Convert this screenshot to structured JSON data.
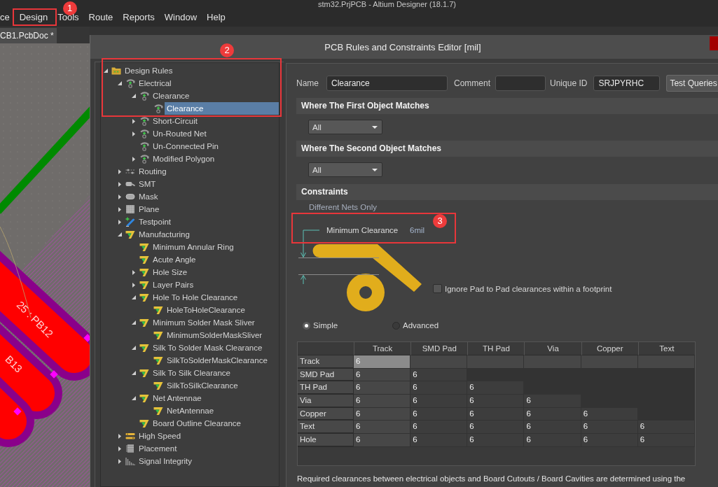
{
  "window": {
    "title": "stm32.PrjPCB - Altium Designer (18.1.7)"
  },
  "menu": [
    {
      "label": "ce"
    },
    {
      "label": "Design",
      "callout": "1"
    },
    {
      "label": "Tools"
    },
    {
      "label": "Route"
    },
    {
      "label": "Reports"
    },
    {
      "label": "Window"
    },
    {
      "label": "Help"
    }
  ],
  "document_tabs": [
    {
      "label": "CB1.PcbDoc *",
      "selected": true
    }
  ],
  "pcb_view": {
    "labels": [
      "25 : PB12",
      "B13"
    ]
  },
  "dialog": {
    "title": "PCB Rules and Constraints Editor [mil]",
    "rule_tree": {
      "callout": "2",
      "items": [
        {
          "label": "Design Rules",
          "kind": "folder",
          "expanded": true,
          "selected": false,
          "children": [
            {
              "label": "Electrical",
              "kind": "electrical",
              "expanded": true,
              "selected": false,
              "children": [
                {
                  "label": "Clearance",
                  "kind": "electrical",
                  "expanded": true,
                  "selected": false,
                  "children": [
                    {
                      "label": "Clearance",
                      "kind": "electrical",
                      "selected": true
                    }
                  ]
                },
                {
                  "label": "Short-Circuit",
                  "kind": "electrical",
                  "expanded": false,
                  "selected": false
                },
                {
                  "label": "Un-Routed Net",
                  "kind": "electrical",
                  "expanded": false,
                  "selected": false
                },
                {
                  "label": "Un-Connected Pin",
                  "kind": "electrical",
                  "selected": false
                },
                {
                  "label": "Modified Polygon",
                  "kind": "electrical",
                  "expanded": false,
                  "selected": false
                }
              ]
            },
            {
              "label": "Routing",
              "kind": "routing",
              "expanded": false,
              "selected": false
            },
            {
              "label": "SMT",
              "kind": "smt",
              "expanded": false,
              "selected": false
            },
            {
              "label": "Mask",
              "kind": "mask",
              "expanded": false,
              "selected": false
            },
            {
              "label": "Plane",
              "kind": "plane",
              "expanded": false,
              "selected": false
            },
            {
              "label": "Testpoint",
              "kind": "testpoint",
              "expanded": false,
              "selected": false
            },
            {
              "label": "Manufacturing",
              "kind": "manufacturing",
              "expanded": true,
              "selected": false,
              "children": [
                {
                  "label": "Minimum Annular Ring",
                  "kind": "manufacturing",
                  "selected": false
                },
                {
                  "label": "Acute Angle",
                  "kind": "manufacturing",
                  "selected": false
                },
                {
                  "label": "Hole Size",
                  "kind": "manufacturing",
                  "expanded": false,
                  "selected": false
                },
                {
                  "label": "Layer Pairs",
                  "kind": "manufacturing",
                  "expanded": false,
                  "selected": false
                },
                {
                  "label": "Hole To Hole Clearance",
                  "kind": "manufacturing",
                  "expanded": true,
                  "selected": false,
                  "children": [
                    {
                      "label": "HoleToHoleClearance",
                      "kind": "manufacturing",
                      "selected": false
                    }
                  ]
                },
                {
                  "label": "Minimum Solder Mask Sliver",
                  "kind": "manufacturing",
                  "expanded": true,
                  "selected": false,
                  "children": [
                    {
                      "label": "MinimumSolderMaskSliver",
                      "kind": "manufacturing",
                      "selected": false
                    }
                  ]
                },
                {
                  "label": "Silk To Solder Mask Clearance",
                  "kind": "manufacturing",
                  "expanded": true,
                  "selected": false,
                  "children": [
                    {
                      "label": "SilkToSolderMaskClearance",
                      "kind": "manufacturing",
                      "selected": false
                    }
                  ]
                },
                {
                  "label": "Silk To Silk Clearance",
                  "kind": "manufacturing",
                  "expanded": true,
                  "selected": false,
                  "children": [
                    {
                      "label": "SilkToSilkClearance",
                      "kind": "manufacturing",
                      "selected": false
                    }
                  ]
                },
                {
                  "label": "Net Antennae",
                  "kind": "manufacturing",
                  "expanded": true,
                  "selected": false,
                  "children": [
                    {
                      "label": "NetAntennae",
                      "kind": "manufacturing",
                      "selected": false
                    }
                  ]
                },
                {
                  "label": "Board Outline Clearance",
                  "kind": "manufacturing",
                  "selected": false
                }
              ]
            },
            {
              "label": "High Speed",
              "kind": "high-speed",
              "expanded": false,
              "selected": false
            },
            {
              "label": "Placement",
              "kind": "placement",
              "expanded": false,
              "selected": false
            },
            {
              "label": "Signal Integrity",
              "kind": "signal-integrity",
              "expanded": false,
              "selected": false
            }
          ]
        }
      ]
    },
    "rule": {
      "name_label": "Name",
      "name": "Clearance",
      "comment_label": "Comment",
      "unique_id_label": "Unique ID",
      "unique_id": "SRJPYRHC",
      "test_button": "Test Queries"
    },
    "first_match": {
      "heading": "Where The First Object Matches",
      "query": "All"
    },
    "second_match": {
      "heading": "Where The Second Object Matches",
      "query": "All"
    },
    "constraints": {
      "heading": "Constraints",
      "callout": "3",
      "net_scope": "Different Nets Only",
      "min_clearance_label": "Minimum Clearance",
      "min_clearance": "6mil",
      "ignore_pad_to_pad": {
        "label": "Ignore Pad to Pad clearances within a footprint",
        "checked": false
      },
      "modes": [
        {
          "label": "Simple",
          "selected": true
        },
        {
          "label": "Advanced",
          "selected": false
        }
      ],
      "matrix": {
        "columns": [
          "Track",
          "SMD Pad",
          "TH Pad",
          "Via",
          "Copper",
          "Text"
        ],
        "rows": [
          {
            "label": "Track",
            "cells": [
              {
                "value": "6",
                "selected": true
              }
            ]
          },
          {
            "label": "SMD Pad",
            "cells": [
              {
                "value": "6",
                "selected": false
              },
              {
                "value": "6",
                "selected": false
              }
            ]
          },
          {
            "label": "TH Pad",
            "cells": [
              {
                "value": "6",
                "selected": false
              },
              {
                "value": "6",
                "selected": false
              },
              {
                "value": "6",
                "selected": false
              }
            ]
          },
          {
            "label": "Via",
            "cells": [
              {
                "value": "6",
                "selected": false
              },
              {
                "value": "6",
                "selected": false
              },
              {
                "value": "6",
                "selected": false
              },
              {
                "value": "6",
                "selected": false
              }
            ]
          },
          {
            "label": "Copper",
            "cells": [
              {
                "value": "6",
                "selected": false
              },
              {
                "value": "6",
                "selected": false
              },
              {
                "value": "6",
                "selected": false
              },
              {
                "value": "6",
                "selected": false
              },
              {
                "value": "6",
                "selected": false
              }
            ]
          },
          {
            "label": "Text",
            "cells": [
              {
                "value": "6",
                "selected": false
              },
              {
                "value": "6",
                "selected": false
              },
              {
                "value": "6",
                "selected": false
              },
              {
                "value": "6",
                "selected": false
              },
              {
                "value": "6",
                "selected": false
              },
              {
                "value": "6",
                "selected": false
              }
            ]
          },
          {
            "label": "Hole",
            "cells": [
              {
                "value": "6",
                "selected": false
              },
              {
                "value": "6",
                "selected": false
              },
              {
                "value": "6",
                "selected": false
              },
              {
                "value": "6",
                "selected": false
              },
              {
                "value": "6",
                "selected": false
              },
              {
                "value": "6",
                "selected": false
              }
            ]
          }
        ]
      }
    },
    "note": "Required clearances between electrical objects and Board Cutouts / Board Cavities are determined using the"
  }
}
